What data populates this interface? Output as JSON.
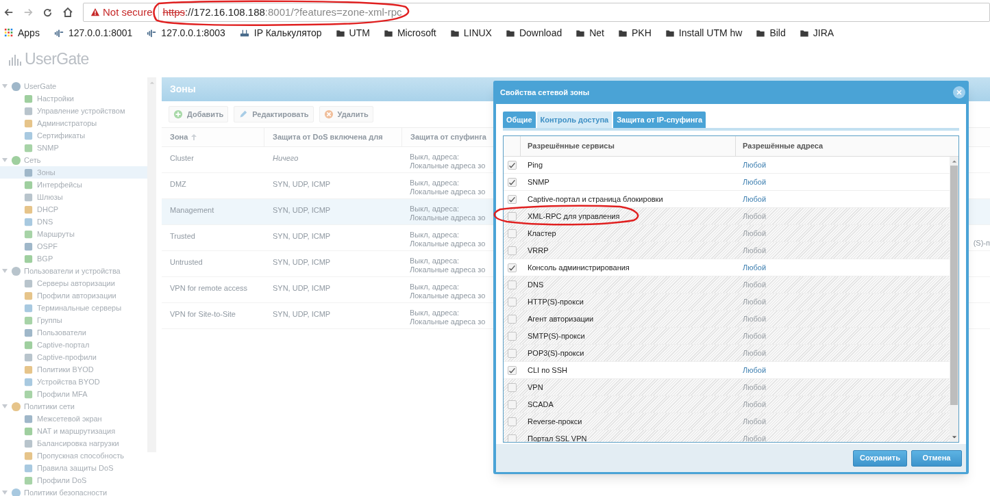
{
  "browser": {
    "address": {
      "warning": "Not secure",
      "scheme": "https",
      "host": "://172.16.108.188",
      "rest": ":8001/?features=zone-xml-rpc"
    },
    "bookmarks": [
      {
        "label": "Apps",
        "kind": "apps"
      },
      {
        "label": "127.0.0.1:8001",
        "kind": "link"
      },
      {
        "label": "127.0.0.1:8003",
        "kind": "link"
      },
      {
        "label": "IP Калькулятор",
        "kind": "router"
      },
      {
        "label": "UTM",
        "kind": "folder"
      },
      {
        "label": "Microsoft",
        "kind": "folder"
      },
      {
        "label": "LINUX",
        "kind": "folder"
      },
      {
        "label": "Download",
        "kind": "folder"
      },
      {
        "label": "Net",
        "kind": "folder"
      },
      {
        "label": "PKH",
        "kind": "folder"
      },
      {
        "label": "Install UTM hw",
        "kind": "folder"
      },
      {
        "label": "Bild",
        "kind": "folder"
      },
      {
        "label": "JIRA",
        "kind": "folder"
      }
    ]
  },
  "app": {
    "logo": "UserGate"
  },
  "sidebar": {
    "items": [
      {
        "label": "UserGate",
        "expanded": true,
        "selected": false,
        "children": [
          {
            "label": "Настройки",
            "selected": false
          },
          {
            "label": "Управление устройством",
            "selected": false
          },
          {
            "label": "Администраторы",
            "selected": false
          },
          {
            "label": "Сертификаты",
            "selected": false
          },
          {
            "label": "SNMP",
            "selected": false
          }
        ]
      },
      {
        "label": "Сеть",
        "expanded": true,
        "selected": false,
        "children": [
          {
            "label": "Зоны",
            "selected": true
          },
          {
            "label": "Интерфейсы",
            "selected": false
          },
          {
            "label": "Шлюзы",
            "selected": false
          },
          {
            "label": "DHCP",
            "selected": false
          },
          {
            "label": "DNS",
            "selected": false
          },
          {
            "label": "Маршруты",
            "selected": false
          },
          {
            "label": "OSPF",
            "selected": false
          },
          {
            "label": "BGP",
            "selected": false
          }
        ]
      },
      {
        "label": "Пользователи и устройства",
        "expanded": true,
        "selected": false,
        "children": [
          {
            "label": "Серверы авторизации",
            "selected": false
          },
          {
            "label": "Профили авторизации",
            "selected": false
          },
          {
            "label": "Терминальные серверы",
            "selected": false
          },
          {
            "label": "Группы",
            "selected": false
          },
          {
            "label": "Пользователи",
            "selected": false
          },
          {
            "label": "Captive-портал",
            "selected": false
          },
          {
            "label": "Captive-профили",
            "selected": false
          },
          {
            "label": "Политики BYOD",
            "selected": false
          },
          {
            "label": "Устройства BYOD",
            "selected": false
          },
          {
            "label": "Профили MFA",
            "selected": false
          }
        ]
      },
      {
        "label": "Политики сети",
        "expanded": true,
        "selected": false,
        "children": [
          {
            "label": "Межсетевой экран",
            "selected": false
          },
          {
            "label": "NAT и маршрутизация",
            "selected": false
          },
          {
            "label": "Балансировка нагрузки",
            "selected": false
          },
          {
            "label": "Пропускная способность",
            "selected": false
          },
          {
            "label": "Правила защиты DoS",
            "selected": false
          },
          {
            "label": "Профили DoS",
            "selected": false
          }
        ]
      },
      {
        "label": "Политики безопасности",
        "expanded": true,
        "selected": false
      }
    ]
  },
  "main": {
    "title": "Зоны",
    "toolbar": [
      {
        "label": "Добавить",
        "kind": "add"
      },
      {
        "label": "Редактировать",
        "kind": "edit"
      },
      {
        "label": "Удалить",
        "kind": "delete"
      }
    ],
    "table": {
      "columns": [
        {
          "label": "Зона",
          "sorted": true
        },
        {
          "label": "Защита от DoS включена для",
          "sorted": false
        },
        {
          "label": "Защита от спуфинга",
          "sorted": false
        }
      ],
      "rows": [
        {
          "zone": "Cluster",
          "dos": {
            "text": "Ничего",
            "italic": true
          },
          "spoofing": [
            "Выкл, адреса:",
            "Локальные адреса зо"
          ],
          "selected": false
        },
        {
          "zone": "DMZ",
          "dos": {
            "text": "SYN, UDP, ICMP",
            "italic": false
          },
          "spoofing": [
            "Выкл, адреса:",
            "Локальные адреса зо"
          ],
          "selected": false
        },
        {
          "zone": "Management",
          "dos": {
            "text": "SYN, UDP, ICMP",
            "italic": false
          },
          "spoofing": [
            "Выкл, адреса:",
            "Локальные адреса зо"
          ],
          "selected": true
        },
        {
          "zone": "Trusted",
          "dos": {
            "text": "SYN, UDP, ICMP",
            "italic": false
          },
          "spoofing": [
            "Выкл, адреса:",
            "Локальные адреса зо"
          ],
          "selected": false,
          "column_4": "(S)-п"
        },
        {
          "zone": "Untrusted",
          "dos": {
            "text": "SYN, UDP, ICMP",
            "italic": false
          },
          "spoofing": [
            "Выкл, адреса:",
            "Локальные адреса зо"
          ],
          "selected": false
        },
        {
          "zone": "VPN for remote access",
          "dos": {
            "text": "SYN, UDP, ICMP",
            "italic": false
          },
          "spoofing": [
            "Выкл, адреса:",
            "Локальные адреса зо"
          ],
          "selected": false
        },
        {
          "zone": "VPN for Site-to-Site",
          "dos": {
            "text": "SYN, UDP, ICMP",
            "italic": false
          },
          "spoofing": [
            "Выкл, адреса:",
            "Локальные адреса зо"
          ],
          "selected": false
        }
      ]
    }
  },
  "dialog": {
    "title": "Свойства сетевой зоны",
    "tabs": [
      {
        "label": "Общие",
        "selected": false
      },
      {
        "label": "Контроль доступа",
        "selected": true
      },
      {
        "label": "Защита от IP-спуфинга",
        "selected": false
      }
    ],
    "table": {
      "columns": [
        "Разрешённые сервисы",
        "Разрешённые адреса"
      ],
      "rows": [
        {
          "service": "Ping",
          "addresses": "Любой",
          "checked": true
        },
        {
          "service": "SNMP",
          "addresses": "Любой",
          "checked": true
        },
        {
          "service": "Captive-портал и страница блокировки",
          "addresses": "Любой",
          "checked": true
        },
        {
          "service": "XML-RPC для управления",
          "addresses": "Любой",
          "checked": false
        },
        {
          "service": "Кластер",
          "addresses": "Любой",
          "checked": false
        },
        {
          "service": "VRRP",
          "addresses": "Любой",
          "checked": false
        },
        {
          "service": "Консоль администрирования",
          "addresses": "Любой",
          "checked": true
        },
        {
          "service": "DNS",
          "addresses": "Любой",
          "checked": false
        },
        {
          "service": "HTTP(S)-прокси",
          "addresses": "Любой",
          "checked": false
        },
        {
          "service": "Агент авторизации",
          "addresses": "Любой",
          "checked": false
        },
        {
          "service": "SMTP(S)-прокси",
          "addresses": "Любой",
          "checked": false
        },
        {
          "service": "POP3(S)-прокси",
          "addresses": "Любой",
          "checked": false
        },
        {
          "service": "CLI по SSH",
          "addresses": "Любой",
          "checked": true
        },
        {
          "service": "VPN",
          "addresses": "Любой",
          "checked": false
        },
        {
          "service": "SCADA",
          "addresses": "Любой",
          "checked": false
        },
        {
          "service": "Reverse-прокси",
          "addresses": "Любой",
          "checked": false
        },
        {
          "service": "Портал SSL VPN",
          "addresses": "Любой",
          "checked": false
        }
      ]
    },
    "buttons": [
      {
        "label": "Сохранить"
      },
      {
        "label": "Отмена"
      }
    ]
  }
}
